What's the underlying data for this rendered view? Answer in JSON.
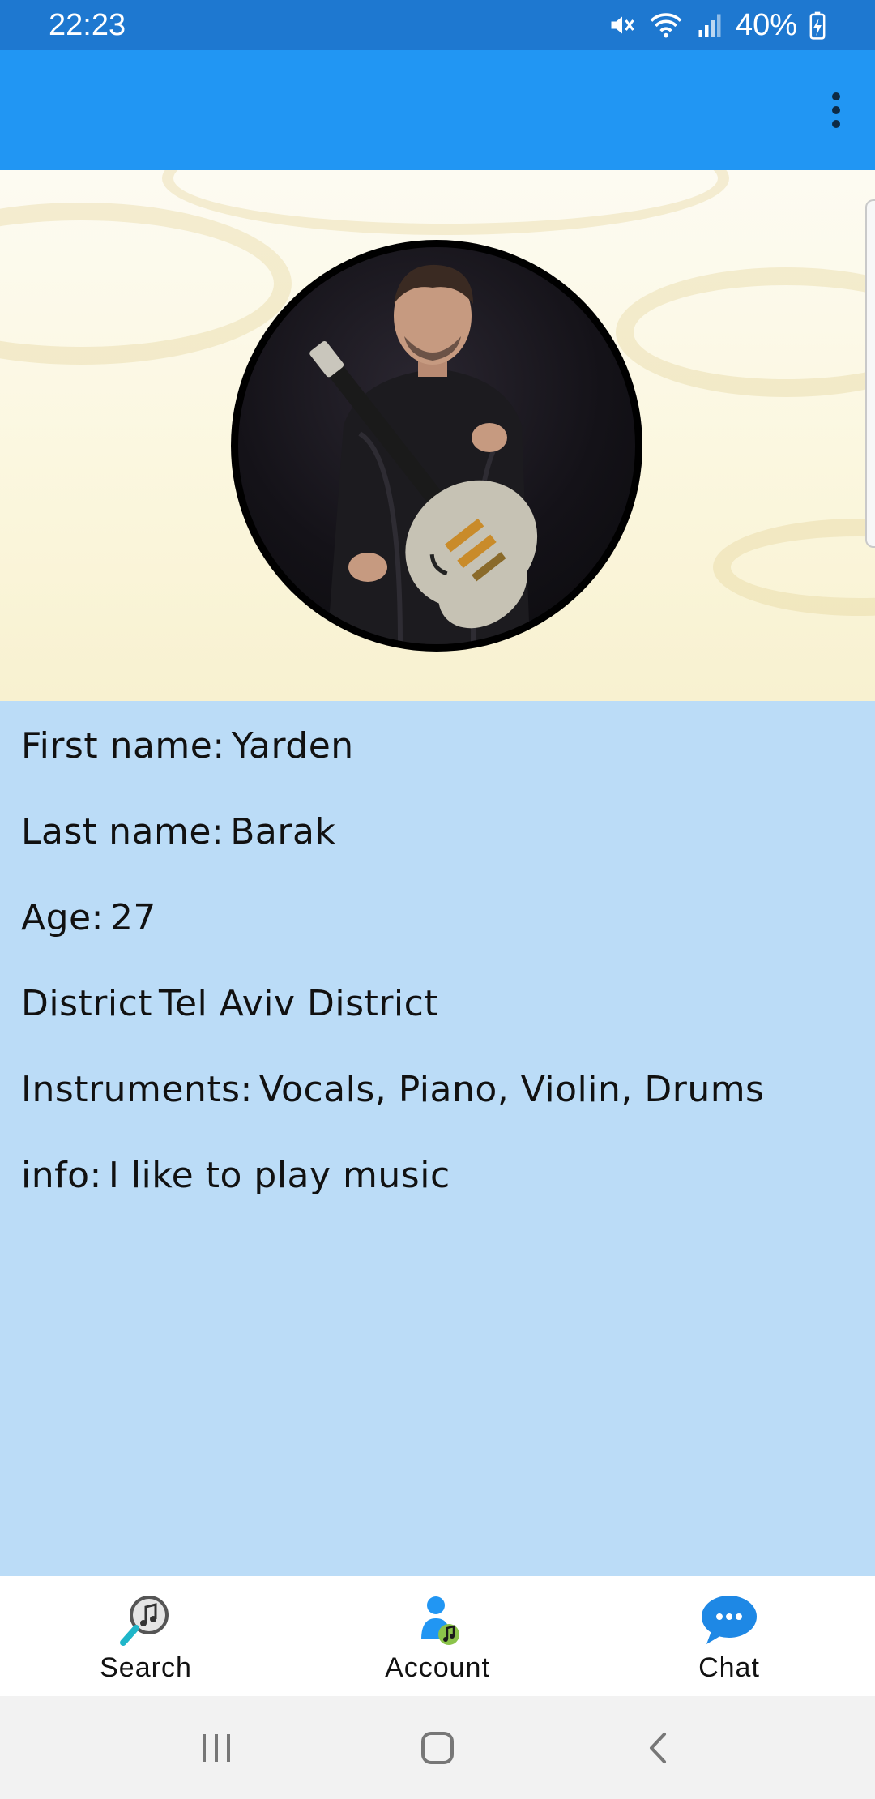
{
  "status_bar": {
    "time": "22:23",
    "battery": "40%",
    "icons": [
      "mute-icon",
      "wifi-icon",
      "signal-icon",
      "battery-charging-icon"
    ]
  },
  "app_bar": {
    "menu_icon": "more-vert-icon"
  },
  "profile": {
    "photo_alt": "profile-photo",
    "fields": [
      {
        "label": "First name:",
        "value": "Yarden"
      },
      {
        "label": "Last name:",
        "value": "Barak"
      },
      {
        "label": "Age:",
        "value": "27"
      },
      {
        "label": "District",
        "value": "Tel Aviv District"
      },
      {
        "label": "Instruments:",
        "value": "Vocals, Piano, Violin, Drums"
      },
      {
        "label": "info:",
        "value": "I like to play music"
      }
    ]
  },
  "bottom_nav": {
    "items": [
      {
        "label": "Search",
        "icon": "music-search-icon"
      },
      {
        "label": "Account",
        "icon": "account-music-icon"
      },
      {
        "label": "Chat",
        "icon": "chat-bubble-icon"
      }
    ]
  },
  "colors": {
    "status_bar": "#1e78d0",
    "app_bar": "#2196f3",
    "details_bg": "#bbdcf7"
  }
}
